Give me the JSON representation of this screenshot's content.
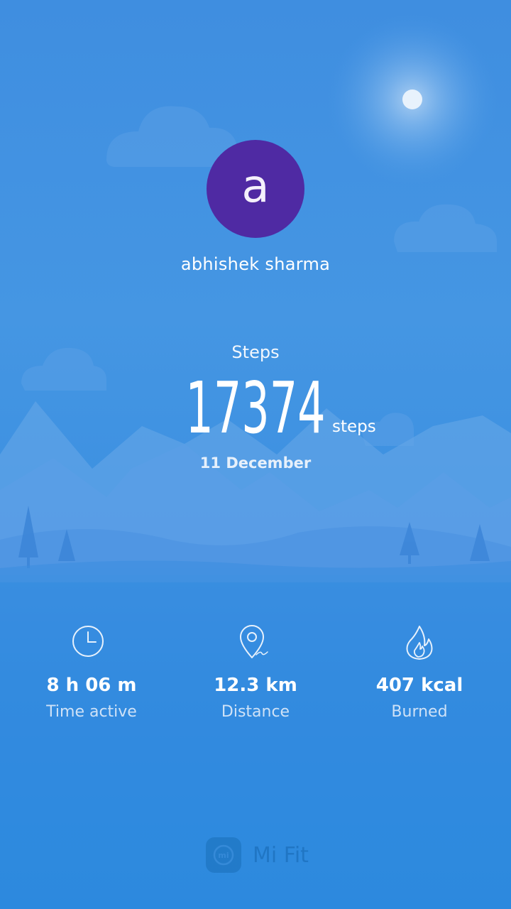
{
  "profile": {
    "avatar_initial": "a",
    "name": "abhishek sharma"
  },
  "steps": {
    "label": "Steps",
    "value": "17374",
    "unit": "steps",
    "date": "11 December"
  },
  "stats": {
    "time_active": {
      "icon": "clock-icon",
      "value": "8 h 06 m",
      "label": "Time active"
    },
    "distance": {
      "icon": "location-pin-icon",
      "value": "12.3 km",
      "label": "Distance"
    },
    "calories": {
      "icon": "flame-icon",
      "value": "407 kcal",
      "label": "Burned"
    }
  },
  "brand": {
    "logo_text": "mi",
    "name": "Mi Fit"
  },
  "colors": {
    "avatar": "#4f2aa3",
    "background_top": "#3f8ee0",
    "background_bottom": "#1c84dc"
  }
}
